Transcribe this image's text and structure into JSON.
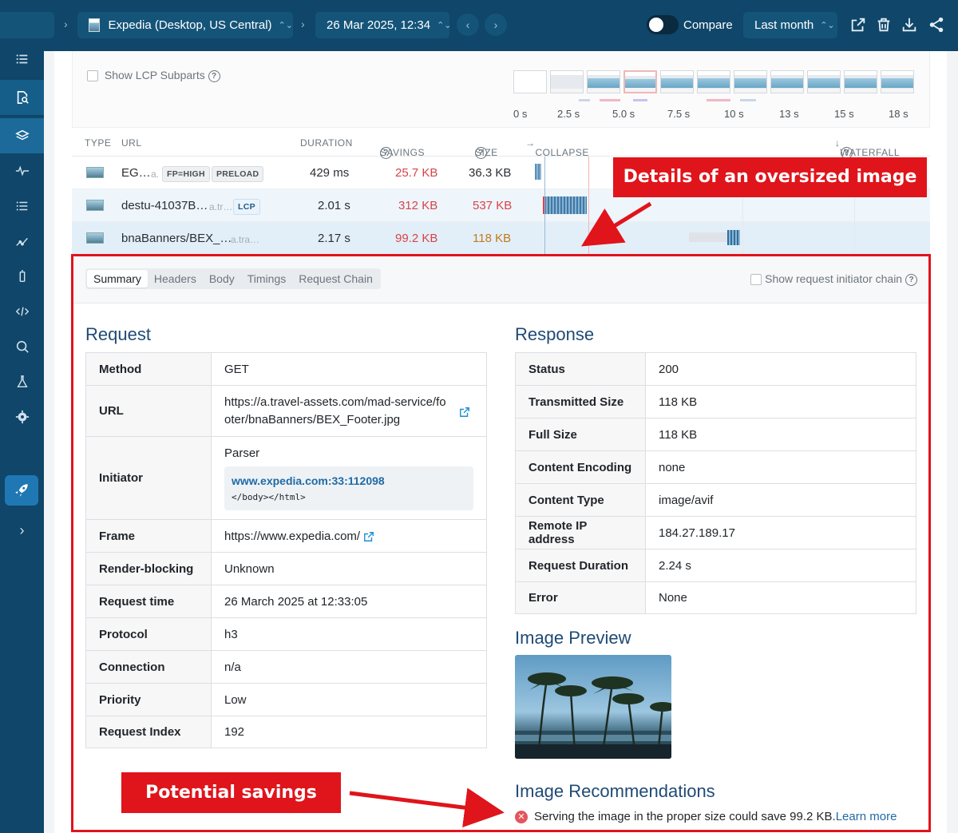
{
  "topbar": {
    "site_label": "Expedia (Desktop, US Central)",
    "date_label": "26 Mar 2025, 12:34",
    "compare_label": "Compare",
    "range_label": "Last month"
  },
  "lcp": {
    "subparts_label": "Show LCP Subparts",
    "ticks": [
      "0 s",
      "2.5 s",
      "5.0 s",
      "7.5 s",
      "10 s",
      "13 s",
      "15 s",
      "18 s"
    ]
  },
  "table": {
    "headers": {
      "type": "TYPE",
      "url": "URL",
      "duration": "DURATION",
      "savings": "SAVINGS",
      "size": "SIZE",
      "collapse": "COLLAPSE",
      "waterfall": "WATERFALL"
    },
    "rows": [
      {
        "url": "EG…",
        "host": "a.",
        "badges": [
          "FP=HIGH",
          "PRELOAD"
        ],
        "duration": "429 ms",
        "savings": "25.7 KB",
        "size": "36.3 KB"
      },
      {
        "url": "destu-41037B…",
        "host": "a.tr…",
        "badges": [
          "LCP"
        ],
        "duration": "2.01 s",
        "savings": "312 KB",
        "size": "537 KB"
      },
      {
        "url": "bnaBanners/BEX_…",
        "host": "a.tra…",
        "badges": [],
        "duration": "2.17 s",
        "savings": "99.2 KB",
        "size": "118 KB"
      }
    ]
  },
  "details": {
    "tabs": [
      "Summary",
      "Headers",
      "Body",
      "Timings",
      "Request Chain"
    ],
    "initiator_chain_label": "Show request initiator chain",
    "request_title": "Request",
    "response_title": "Response",
    "request": {
      "method_k": "Method",
      "method_v": "GET",
      "url_k": "URL",
      "url_v1": "https://a.travel-assets.com/mad-service/fo",
      "url_v2": "oter/bnaBanners/BEX_Footer.jpg",
      "initiator_k": "Initiator",
      "initiator_v": "Parser",
      "initiator_link": "www.expedia.com:33:112098",
      "initiator_code": "</body></html>",
      "frame_k": "Frame",
      "frame_v": "https://www.expedia.com/",
      "render_k": "Render-blocking",
      "render_v": "Unknown",
      "time_k": "Request time",
      "time_v": "26 March 2025 at 12:33:05",
      "protocol_k": "Protocol",
      "protocol_v": "h3",
      "connection_k": "Connection",
      "connection_v": "n/a",
      "priority_k": "Priority",
      "priority_v": "Low",
      "index_k": "Request Index",
      "index_v": "192"
    },
    "response": [
      {
        "k": "Status",
        "v": "200"
      },
      {
        "k": "Transmitted Size",
        "v": "118 KB"
      },
      {
        "k": "Full Size",
        "v": "118 KB"
      },
      {
        "k": "Content Encoding",
        "v": "none"
      },
      {
        "k": "Content Type",
        "v": "image/avif"
      },
      {
        "k": "Remote IP address",
        "v": "184.27.189.17"
      },
      {
        "k": "Request Duration",
        "v": "2.24 s"
      },
      {
        "k": "Error",
        "v": "None"
      }
    ],
    "preview_title": "Image Preview",
    "recommendations_title": "Image Recommendations",
    "recommendation_text": "Serving the image in the proper size could save 99.2 KB.",
    "learn_more": "Learn more"
  },
  "annotations": {
    "oversized": "Details of an oversized image",
    "savings": "Potential savings"
  },
  "colors": {
    "nav_bg": "#0f4669",
    "accent_red": "#e0141b",
    "title_blue": "#1f4a75",
    "savings_red": "#d8444a"
  }
}
